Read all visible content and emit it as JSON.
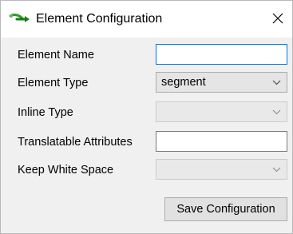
{
  "window": {
    "title": "Element Configuration",
    "icon": "green-arrow-icon",
    "close_icon": "close-icon"
  },
  "form": {
    "element_name": {
      "label": "Element Name",
      "value": ""
    },
    "element_type": {
      "label": "Element Type",
      "value": "segment"
    },
    "inline_type": {
      "label": "Inline Type",
      "value": ""
    },
    "translatable_attributes": {
      "label": "Translatable Attributes",
      "value": ""
    },
    "keep_white_space": {
      "label": "Keep White Space",
      "value": ""
    }
  },
  "actions": {
    "save_label": "Save Configuration"
  },
  "colors": {
    "focus_border": "#0078d7",
    "dialog_bg": "#f0f0f0",
    "icon_green": "#2e9a2a"
  }
}
